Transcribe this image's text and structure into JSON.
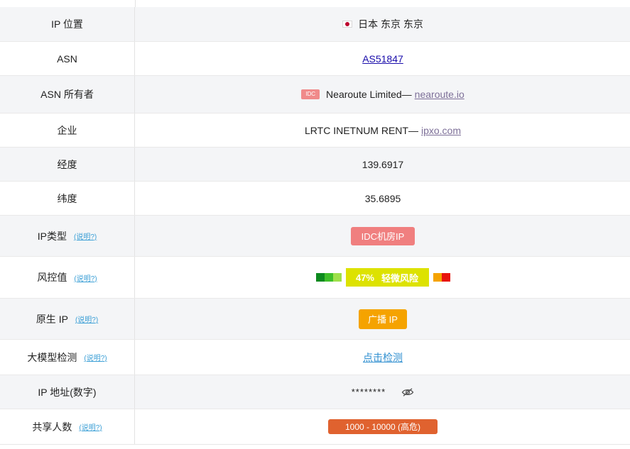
{
  "rows": {
    "ip_location": {
      "label": "IP 位置",
      "flag": "japan-flag",
      "value": "日本 东京 东京"
    },
    "asn": {
      "label": "ASN",
      "value": "AS51847"
    },
    "asn_owner": {
      "label": "ASN 所有者",
      "badge": "IDC",
      "name": "Nearoute Limited—",
      "link": "nearoute.io"
    },
    "enterprise": {
      "label": "企业",
      "name": "LRTC INETNUM RENT—",
      "link": "ipxo.com"
    },
    "longitude": {
      "label": "经度",
      "value": "139.6917"
    },
    "latitude": {
      "label": "纬度",
      "value": "35.6895"
    },
    "ip_type": {
      "label": "IP类型",
      "help": "(说明?)",
      "value": "IDC机房IP"
    },
    "risk": {
      "label": "风控值",
      "help": "(说明?)",
      "percent": "47%",
      "text": "轻微风险",
      "left_colors": [
        "#0d8a1f",
        "#3fbf2a",
        "#9ee04a"
      ],
      "right_colors": [
        "#f5a300",
        "#e8140c"
      ]
    },
    "native_ip": {
      "label": "原生 IP",
      "help": "(说明?)",
      "value": "广播 IP"
    },
    "llm_detect": {
      "label": "大模型检测",
      "help": "(说明?)",
      "value": "点击检测"
    },
    "ip_numeric": {
      "label": "IP 地址(数字)",
      "value": "********",
      "icon": "eye-off-icon"
    },
    "shared_users": {
      "label": "共享人数",
      "help": "(说明?)",
      "value": "1000 - 10000 (高危)"
    }
  }
}
